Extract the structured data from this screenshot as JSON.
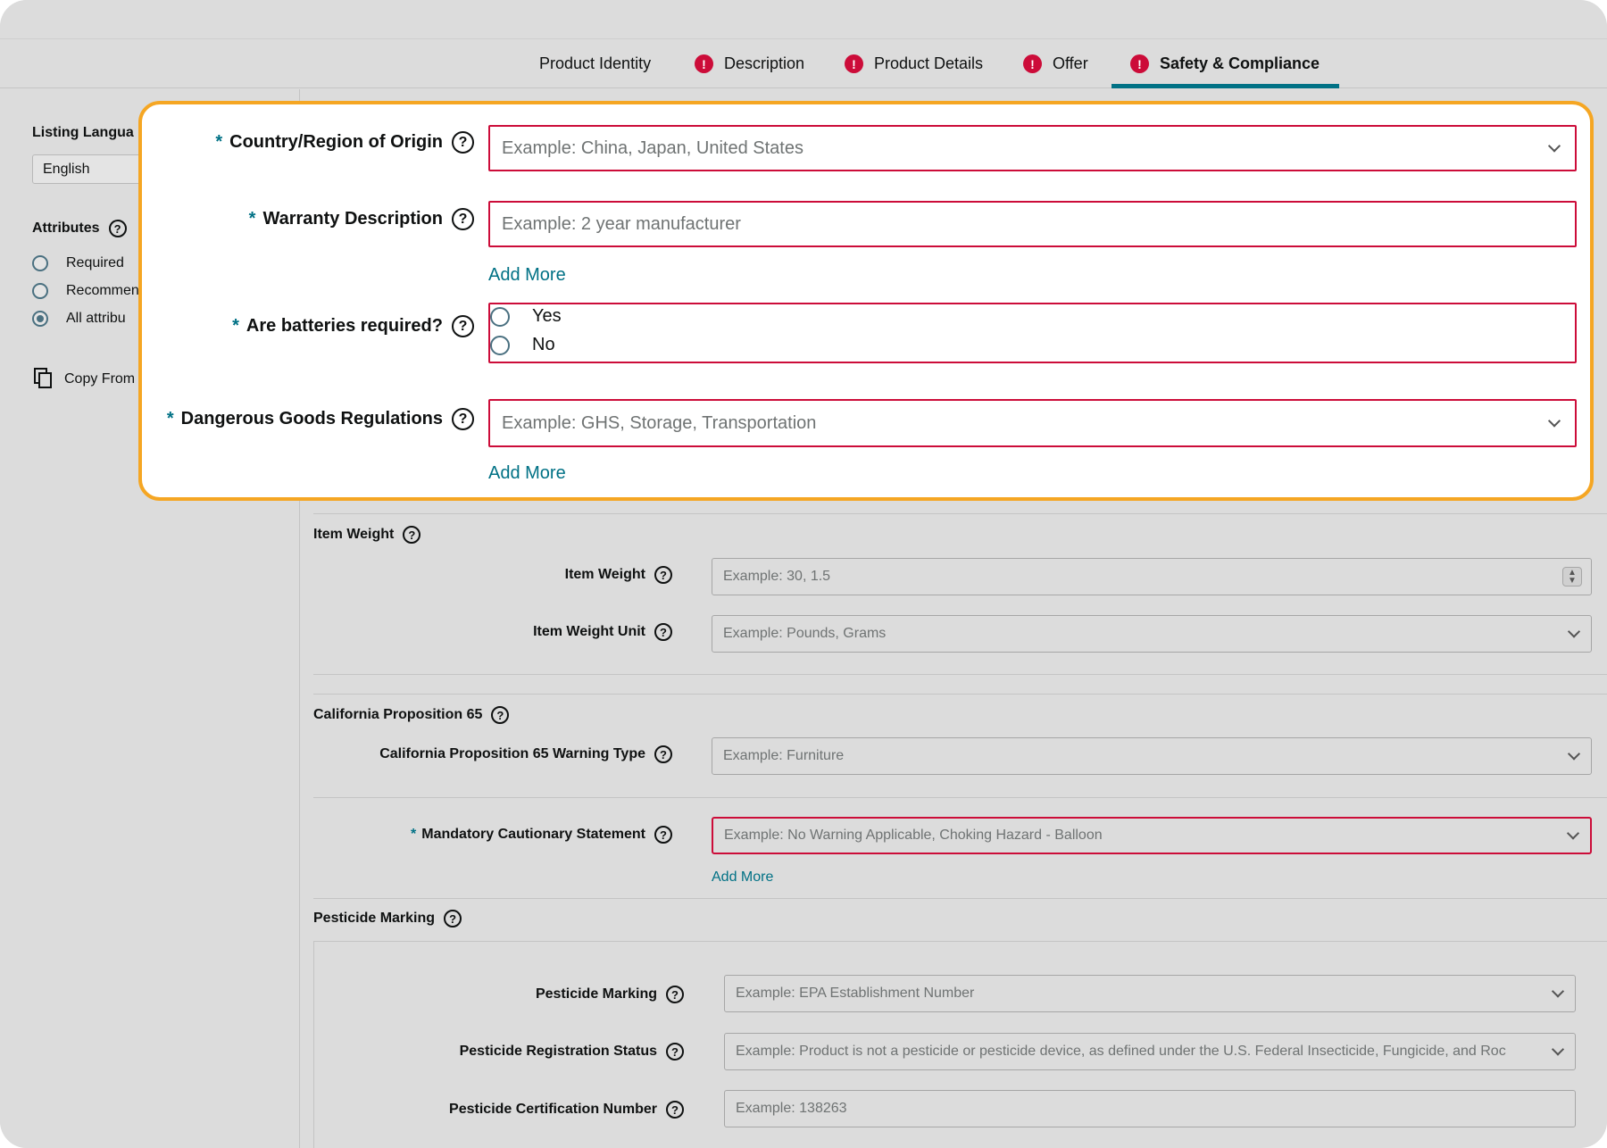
{
  "tabs": [
    {
      "label": "Product Identity",
      "error": false,
      "active": false
    },
    {
      "label": "Description",
      "error": true,
      "active": false
    },
    {
      "label": "Product Details",
      "error": true,
      "active": false
    },
    {
      "label": "Offer",
      "error": true,
      "active": false
    },
    {
      "label": "Safety & Compliance",
      "error": true,
      "active": true
    }
  ],
  "sidebar": {
    "listing_language_label": "Listing Langua",
    "listing_language_value": "English",
    "attributes_label": "Attributes",
    "filters": [
      {
        "label": "Required",
        "selected": false
      },
      {
        "label": "Recommen",
        "selected": false
      },
      {
        "label": "All attribu",
        "selected": true
      }
    ],
    "copy_from_label": "Copy From"
  },
  "overlay": {
    "country_label": "Country/Region of Origin",
    "country_placeholder": "Example: China, Japan, United States",
    "warranty_label": "Warranty Description",
    "warranty_placeholder": "Example: 2 year manufacturer",
    "warranty_add_more": "Add More",
    "batteries_label": "Are batteries required?",
    "batteries_options": [
      "Yes",
      "No"
    ],
    "dangerous_label": "Dangerous Goods Regulations",
    "dangerous_placeholder": "Example: GHS, Storage, Transportation",
    "dangerous_add_more": "Add More"
  },
  "main": {
    "item_weight_section": "Item Weight",
    "item_weight_label": "Item Weight",
    "item_weight_placeholder": "Example: 30, 1.5",
    "item_weight_unit_label": "Item Weight Unit",
    "item_weight_unit_placeholder": "Example: Pounds, Grams",
    "prop65_section": "California Proposition 65",
    "prop65_warning_label": "California Proposition 65 Warning Type",
    "prop65_warning_placeholder": "Example: Furniture",
    "cautionary_label": "Mandatory Cautionary Statement",
    "cautionary_placeholder": "Example: No Warning Applicable, Choking Hazard - Balloon",
    "cautionary_add_more": "Add More",
    "pesticide_section": "Pesticide Marking",
    "pesticide_marking_label": "Pesticide Marking",
    "pesticide_marking_placeholder": "Example: EPA Establishment Number",
    "pesticide_status_label": "Pesticide Registration Status",
    "pesticide_status_placeholder": "Example: Product is not a pesticide or pesticide device, as defined under the U.S. Federal Insecticide, Fungicide, and Roc",
    "pesticide_cert_label": "Pesticide Certification Number",
    "pesticide_cert_placeholder": "Example: 138263"
  },
  "colors": {
    "accent": "#007185",
    "error": "#cc0c39",
    "highlight": "#f5a623"
  }
}
